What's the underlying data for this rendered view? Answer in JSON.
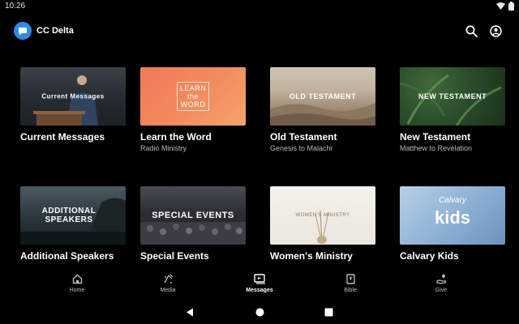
{
  "status": {
    "time": "10:26"
  },
  "app": {
    "title": "CC Delta"
  },
  "cards": [
    {
      "title": "Current Messages",
      "subtitle": "",
      "thumb_text": "Current Messages"
    },
    {
      "title": "Learn the Word",
      "subtitle": "Radio Ministry",
      "thumb_text": "LEARN the WORD"
    },
    {
      "title": "Old Testament",
      "subtitle": "Genesis to Malachi",
      "thumb_text": "OLD TESTAMENT"
    },
    {
      "title": "New Testament",
      "subtitle": "Matthew to Revelation",
      "thumb_text": "NEW TESTAMENT"
    },
    {
      "title": "Additional Speakers",
      "subtitle": "",
      "thumb_text": "ADDITIONAL SPEAKERS"
    },
    {
      "title": "Special Events",
      "subtitle": "",
      "thumb_text": "SPECIAL EVENTS"
    },
    {
      "title": "Women's Ministry",
      "subtitle": "",
      "thumb_text": "WOMEN'S MINISTRY"
    },
    {
      "title": "Calvary Kids",
      "subtitle": "",
      "thumb_text_top": "Calvary",
      "thumb_text": "kids"
    }
  ],
  "nav": {
    "items": [
      {
        "label": "Home",
        "icon": "home-icon",
        "active": false
      },
      {
        "label": "Media",
        "icon": "media-icon",
        "active": false
      },
      {
        "label": "Messages",
        "icon": "messages-icon",
        "active": true
      },
      {
        "label": "Bible",
        "icon": "bible-icon",
        "active": false
      },
      {
        "label": "Give",
        "icon": "give-icon",
        "active": false
      }
    ]
  },
  "colors": {
    "background": "#000000",
    "brand": "#2f8bea",
    "text": "#ffffff",
    "subtext": "#b8b8b8"
  }
}
